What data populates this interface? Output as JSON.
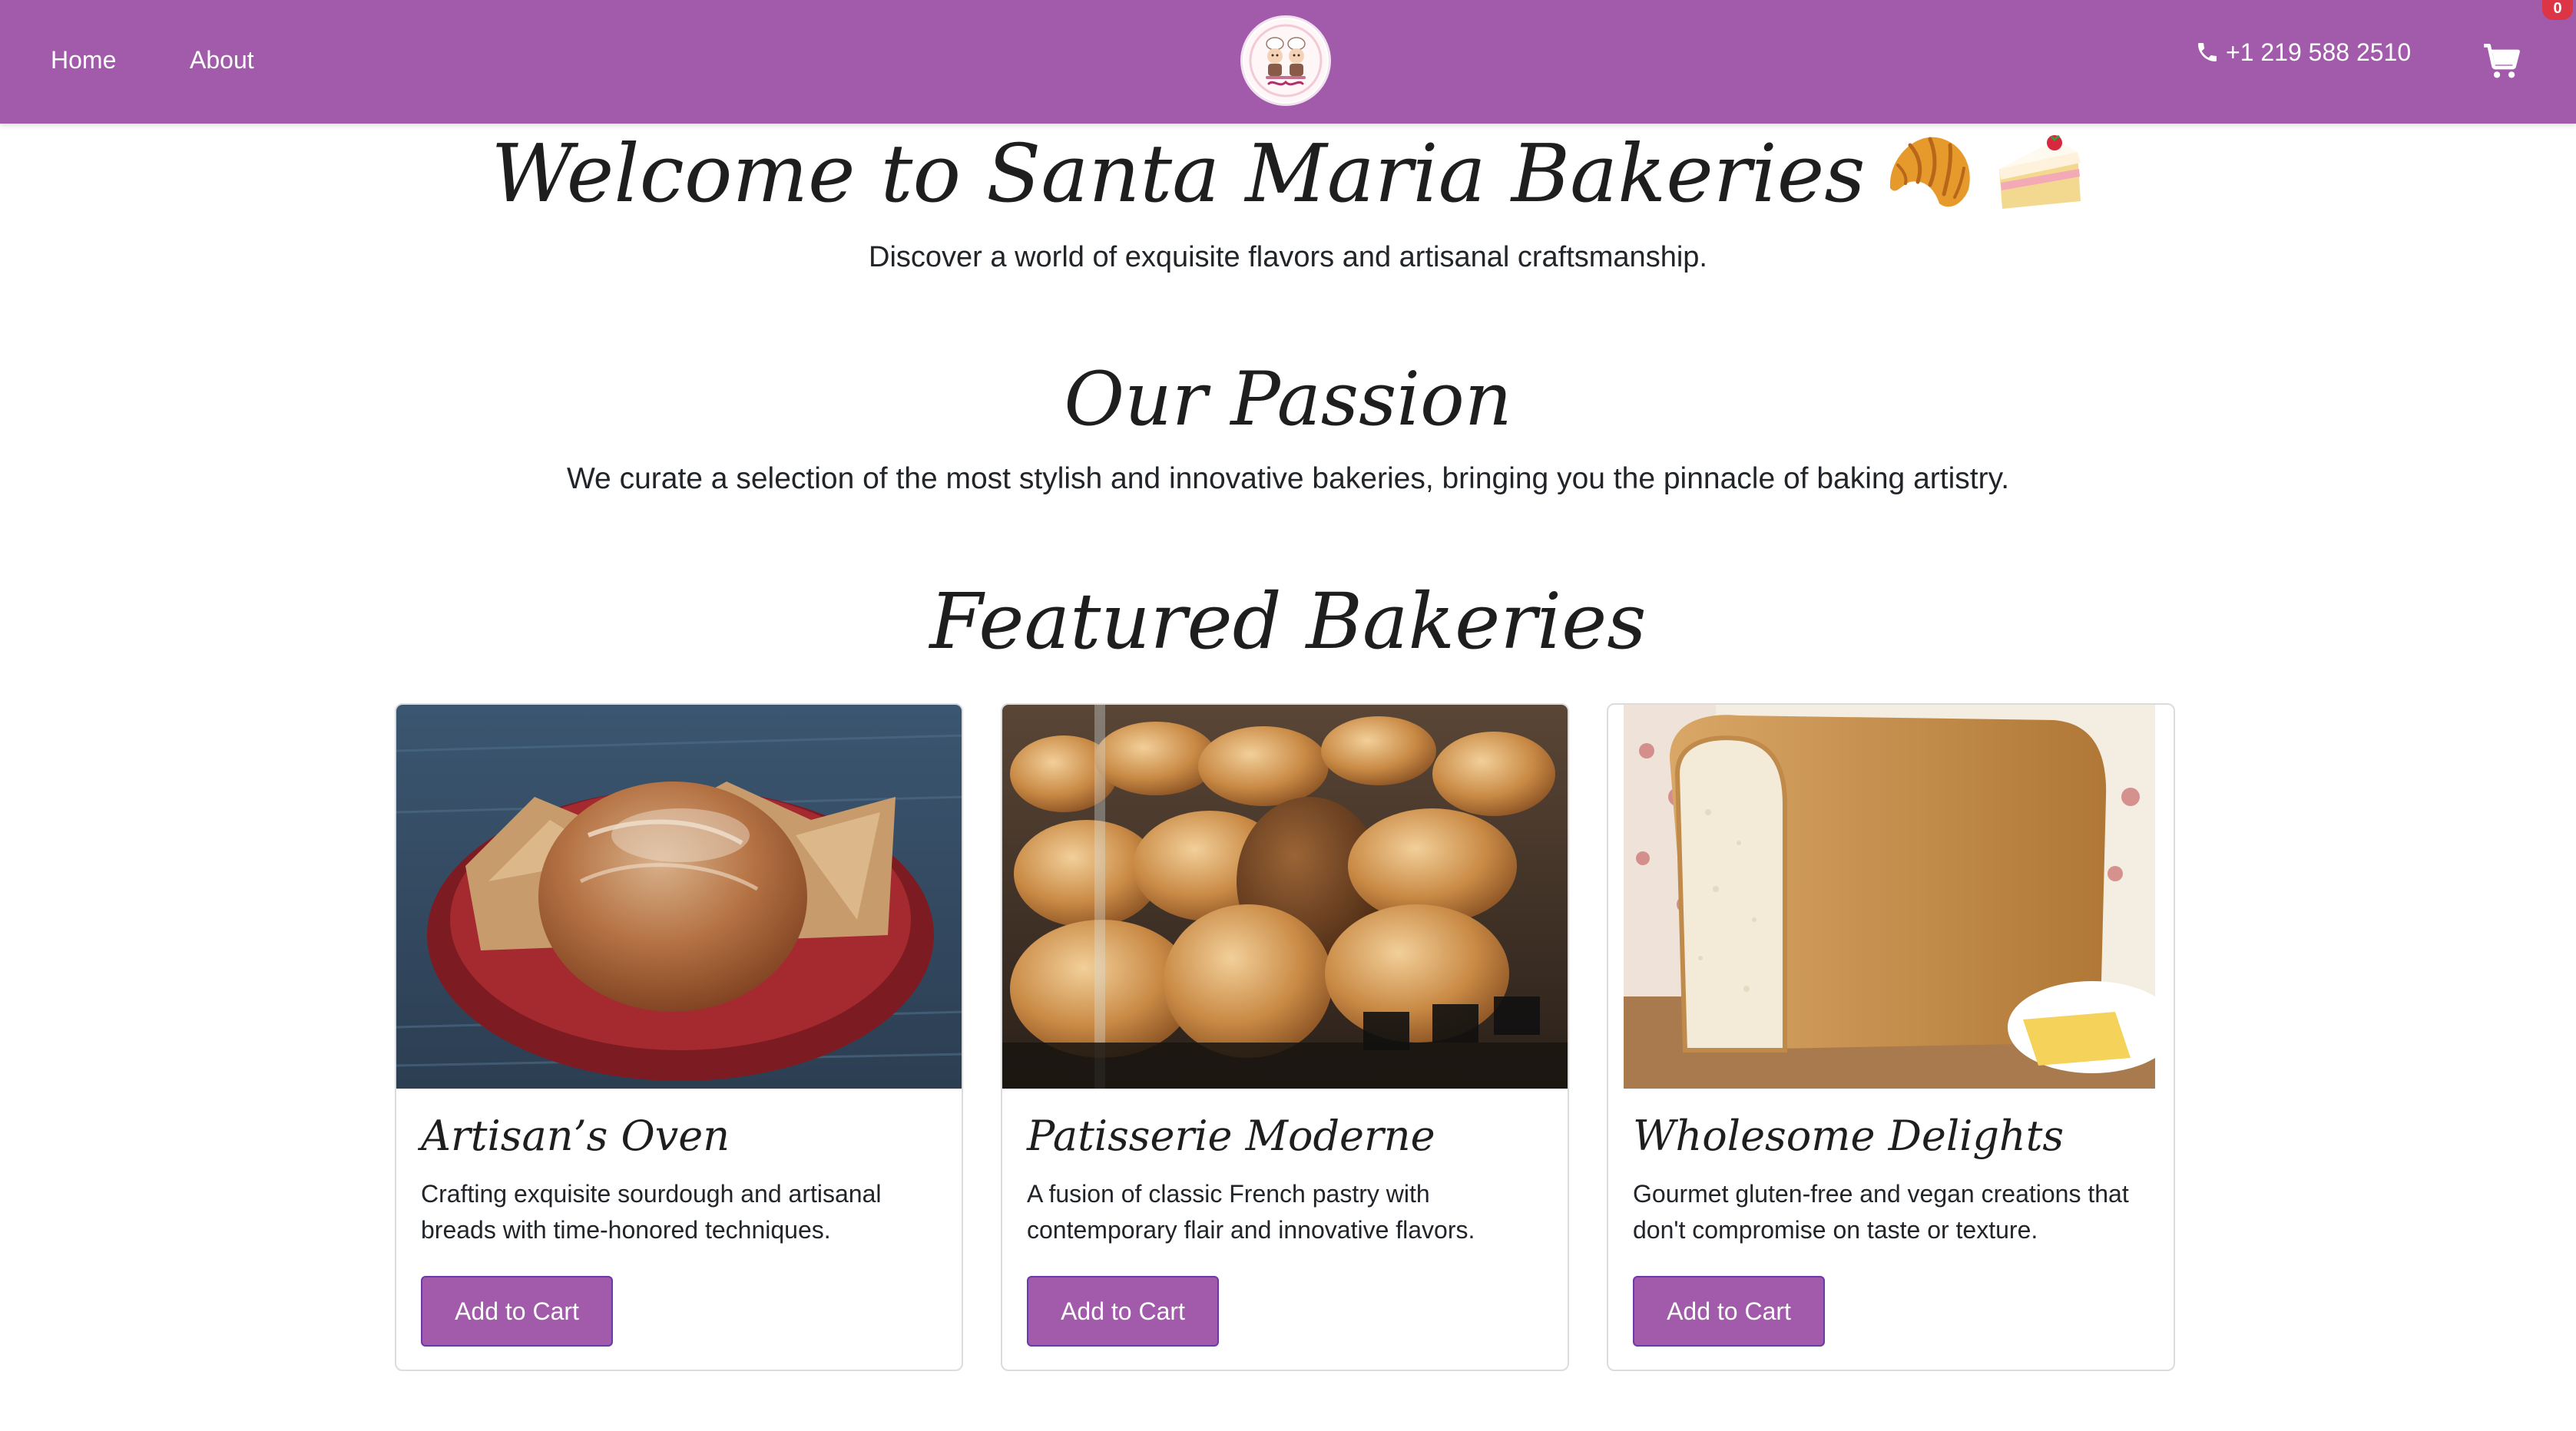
{
  "colors": {
    "brand_purple": "#a25aab",
    "badge_red": "#dc3545",
    "text_dark": "#212529"
  },
  "nav": {
    "links": [
      {
        "label": "Home"
      },
      {
        "label": "About"
      }
    ],
    "logo": {
      "text": "Bakery",
      "icon": "bakery-logo-icon"
    },
    "phone": {
      "icon": "phone-icon",
      "number": "+1 219 588 2510"
    },
    "cart": {
      "icon": "cart-icon",
      "count": "0"
    }
  },
  "hero": {
    "title": "Welcome to Santa Maria Bakeries",
    "emojis": [
      "croissant-emoji",
      "cake-emoji"
    ],
    "subtitle": "Discover a world of exquisite flavors and artisanal craftsmanship."
  },
  "passion": {
    "title": "Our Passion",
    "text": "We curate a selection of the most stylish and innovative bakeries, bringing you the pinnacle of baking artistry."
  },
  "featured": {
    "title": "Featured Bakeries",
    "cards": [
      {
        "title": "Artisan’s Oven",
        "description": "Crafting exquisite sourdough and artisanal breads with time-honored techniques.",
        "button": "Add to Cart",
        "image": "sourdough-loaf-in-dutch-oven"
      },
      {
        "title": "Patisserie Moderne",
        "description": "A fusion of classic French pastry with contemporary flair and innovative flavors.",
        "button": "Add to Cart",
        "image": "bread-loaves-in-display-case"
      },
      {
        "title": "Wholesome Delights",
        "description": "Gourmet gluten-free and vegan creations that don't compromise on taste or texture.",
        "button": "Add to Cart",
        "image": "sliced-white-bread-loaf"
      }
    ]
  }
}
